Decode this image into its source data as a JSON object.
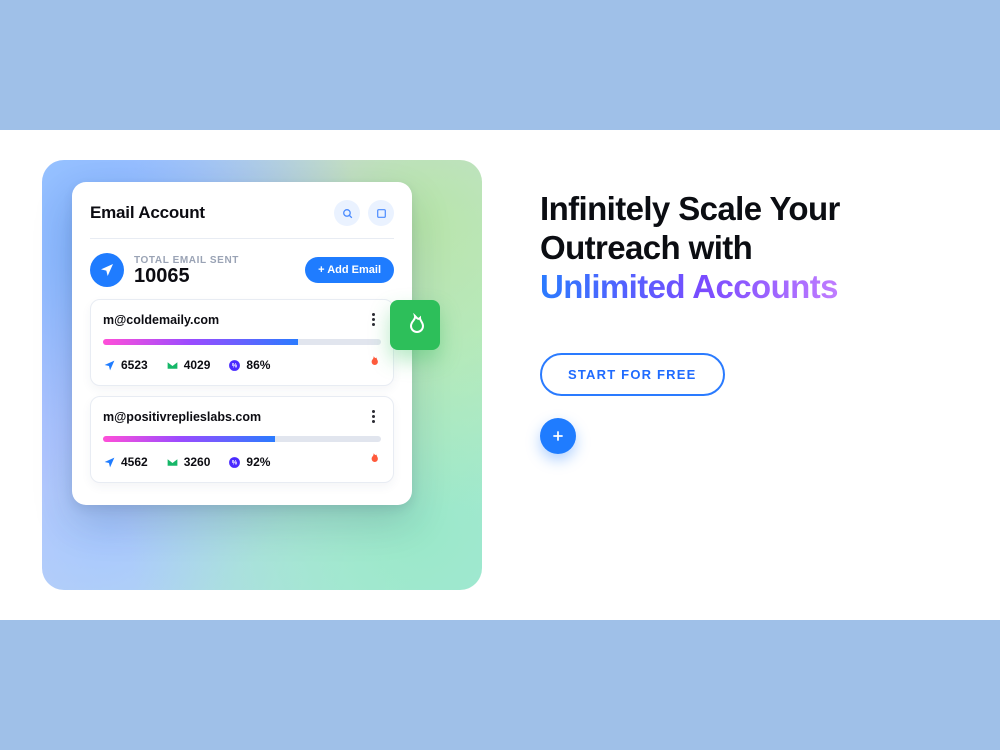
{
  "card": {
    "title": "Email Account",
    "summary_label": "TOTAL EMAIL SENT",
    "summary_value": "10065",
    "add_button": "+ Add Email"
  },
  "accounts": [
    {
      "email": "m@coldemaily.com",
      "progress_pct": 70,
      "sent": "6523",
      "delivered": "4029",
      "rate": "86%"
    },
    {
      "email": "m@positivreplieslabs.com",
      "progress_pct": 62,
      "sent": "4562",
      "delivered": "3260",
      "rate": "92%"
    }
  ],
  "copy": {
    "line1": "Infinitely Scale Your",
    "line2": "Outreach with",
    "highlight": "Unlimited Accounts",
    "cta": "START FOR FREE"
  },
  "colors": {
    "blue": "#1f7cff",
    "green": "#16b768",
    "purple": "#6a3cff",
    "flame": "#ff5a3c"
  }
}
